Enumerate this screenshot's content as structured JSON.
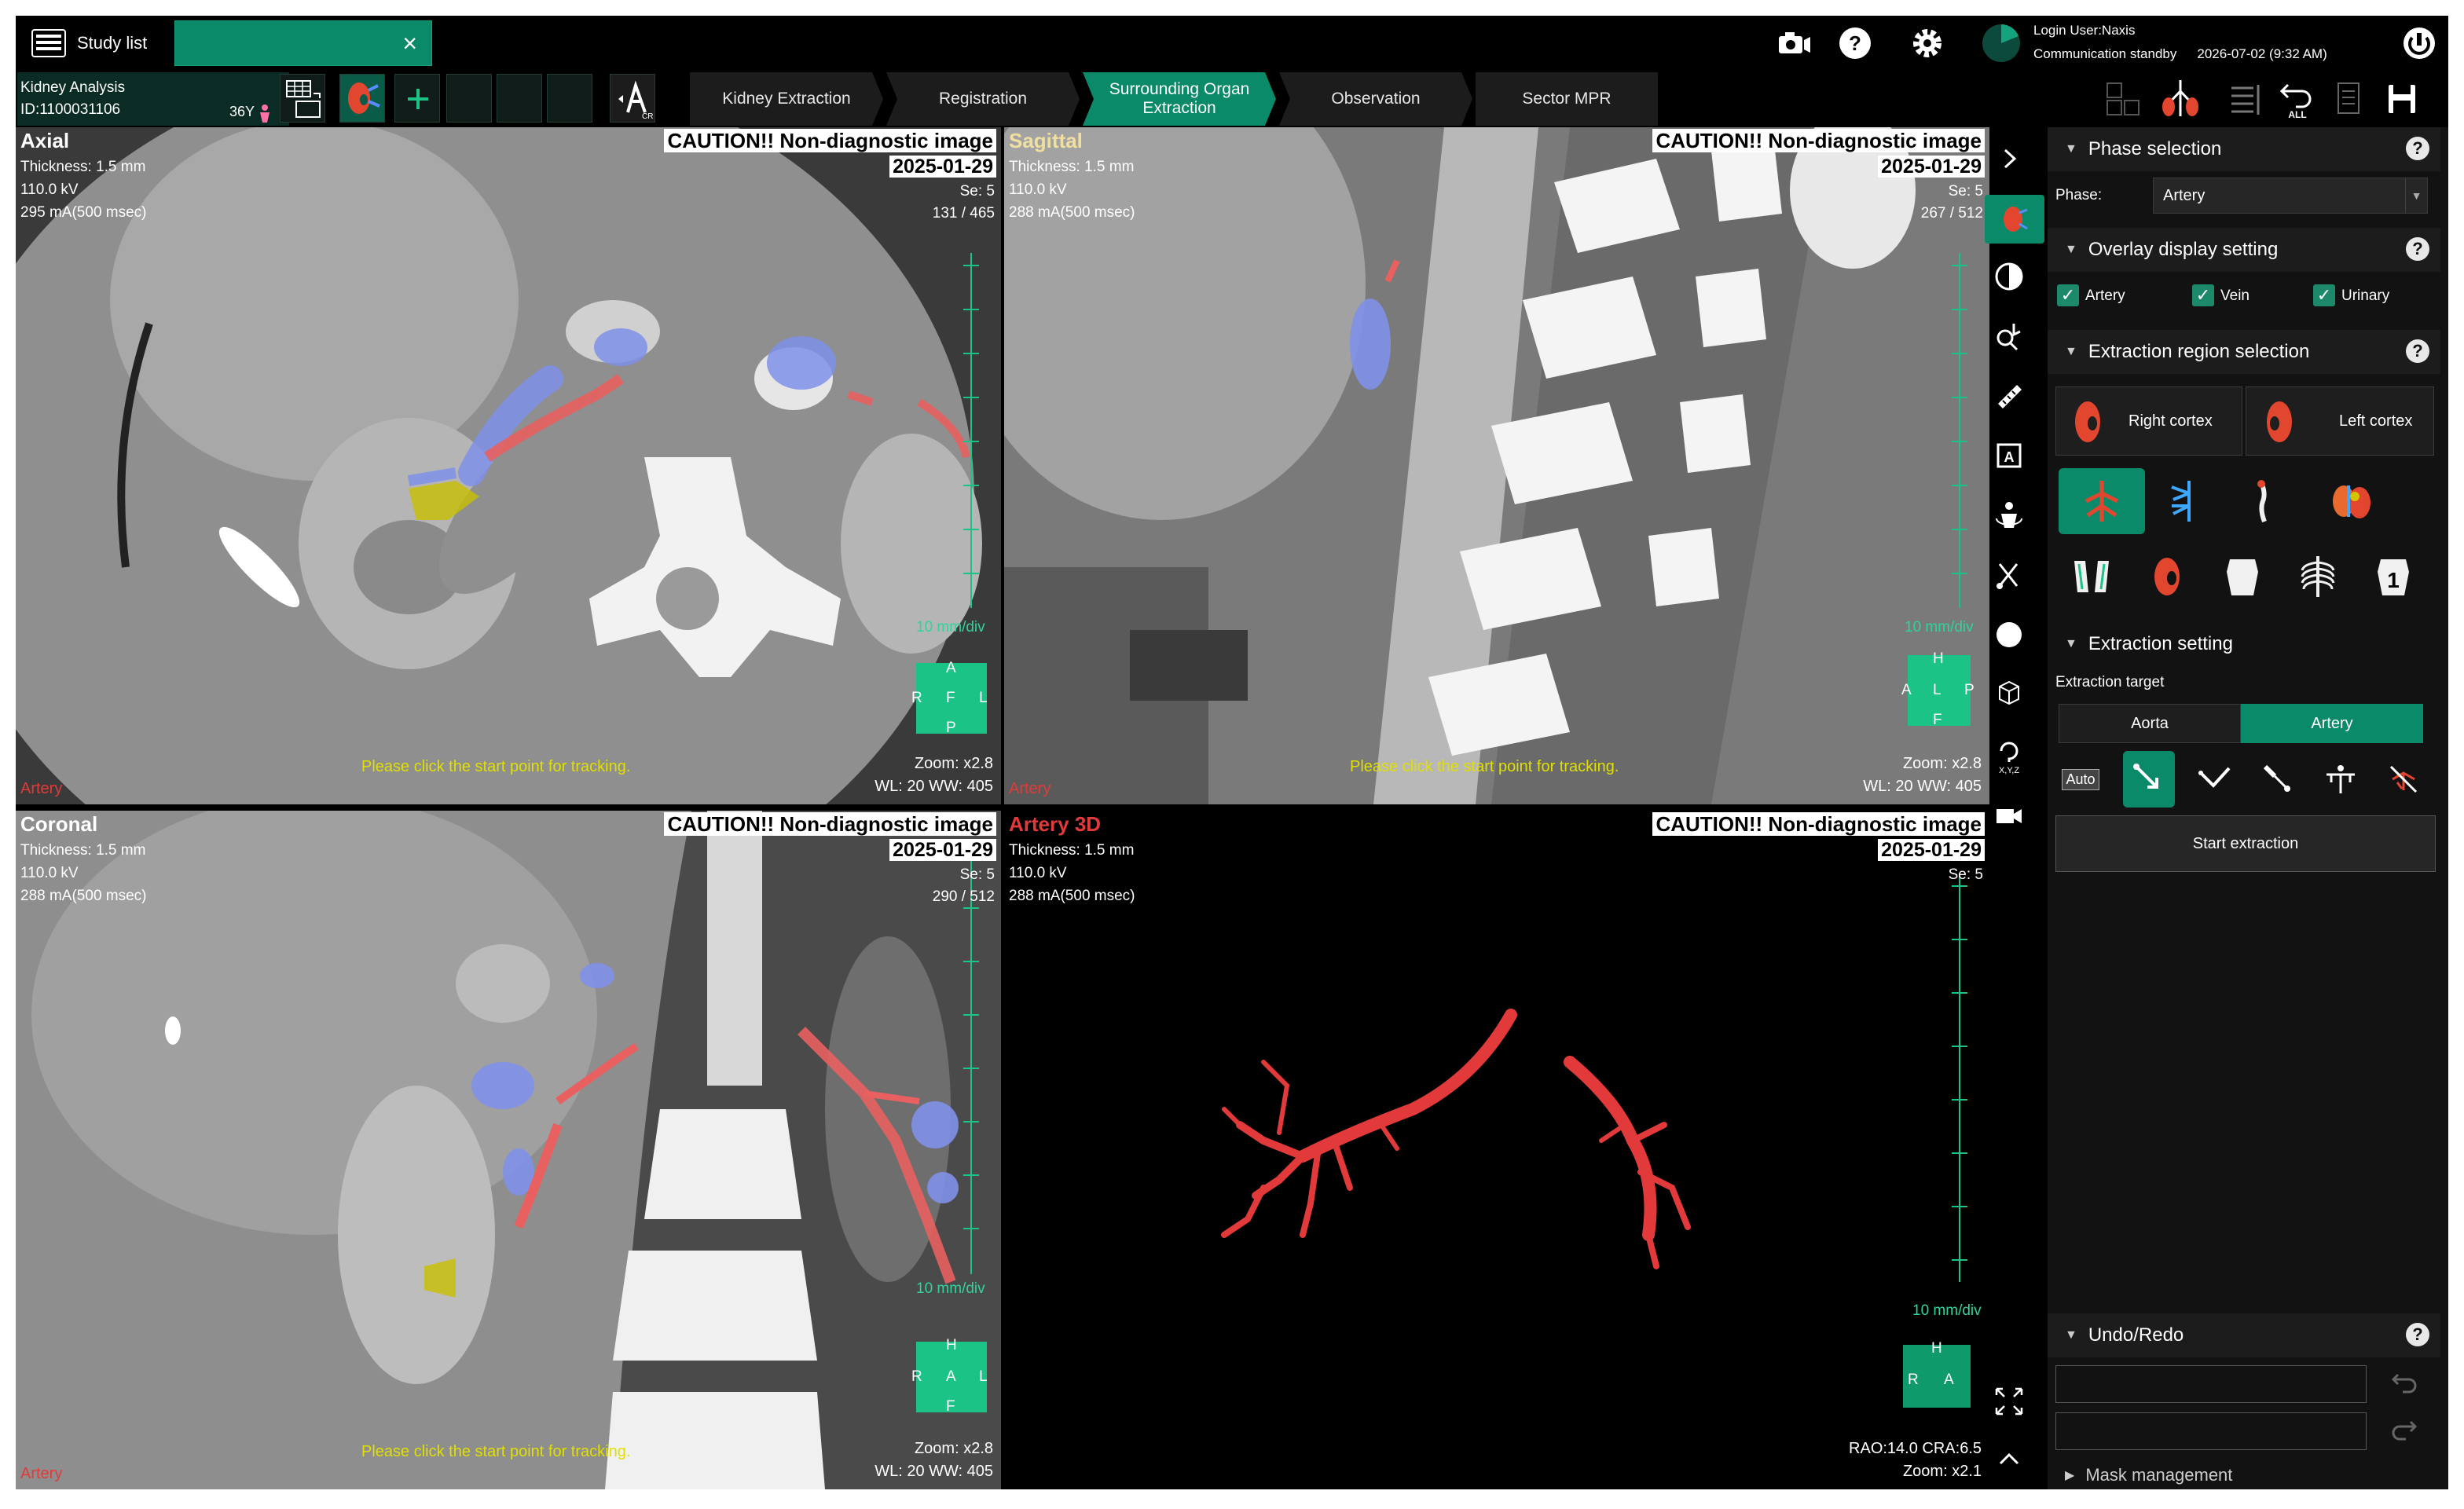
{
  "topbar": {
    "study_list_label": "Study list",
    "login_user": "Login User:Naxis",
    "comm_status": "Communication standby",
    "datetime": "2026-07-02 (9:32 AM)"
  },
  "study": {
    "analysis": "Kidney Analysis",
    "patient_id": "ID:1100031106",
    "age": "36Y"
  },
  "steps": [
    {
      "label": "Kidney Extraction"
    },
    {
      "label": "Registration"
    },
    {
      "label": "Surrounding Organ Extraction"
    },
    {
      "label": "Observation"
    },
    {
      "label": "Sector MPR"
    }
  ],
  "viewports": {
    "axial": {
      "name": "Axial",
      "thickness": "Thickness: 1.5 mm",
      "kv": "110.0 kV",
      "ma": "295 mA(500 msec)",
      "caution": "CAUTION!! Non-diagnostic image",
      "date": "2025-01-29",
      "se": "Se: 5",
      "slice": "131 / 465",
      "scale": "10  mm/div",
      "message": "Please click the start point for tracking.",
      "phase": "Artery",
      "zoom": "Zoom: x2.8",
      "wlww": "WL: 20  WW: 405",
      "orient": {
        "top": "A",
        "left": "R",
        "center": "F",
        "right": "L",
        "bottom": "P"
      }
    },
    "sagittal": {
      "name": "Sagittal",
      "thickness": "Thickness: 1.5 mm",
      "kv": "110.0 kV",
      "ma": "288 mA(500 msec)",
      "caution": "CAUTION!! Non-diagnostic image",
      "date": "2025-01-29",
      "se": "Se: 5",
      "slice": "267 / 512",
      "scale": "10  mm/div",
      "message": "Please click the start point for tracking.",
      "phase": "Artery",
      "zoom": "Zoom: x2.8",
      "wlww": "WL: 20  WW: 405",
      "orient": {
        "top": "H",
        "left": "A",
        "center": "L",
        "right": "P",
        "bottom": "F"
      }
    },
    "coronal": {
      "name": "Coronal",
      "thickness": "Thickness: 1.5 mm",
      "kv": "110.0 kV",
      "ma": "288 mA(500 msec)",
      "caution": "CAUTION!! Non-diagnostic image",
      "date": "2025-01-29",
      "se": "Se: 5",
      "slice": "290 / 512",
      "scale": "10  mm/div",
      "message": "Please click the start point for tracking.",
      "phase": "Artery",
      "zoom": "Zoom: x2.8",
      "wlww": "WL: 20  WW: 405",
      "orient": {
        "top": "H",
        "left": "R",
        "center": "A",
        "right": "L",
        "bottom": "F"
      }
    },
    "vr3d": {
      "name": "Artery 3D",
      "thickness": "Thickness: 1.5 mm",
      "kv": "110.0 kV",
      "ma": "288 mA(500 msec)",
      "caution": "CAUTION!! Non-diagnostic image",
      "date": "2025-01-29",
      "se": "Se: 5",
      "scale": "10  mm/div",
      "angle": "RAO:14.0 CRA:6.5",
      "zoom": "Zoom: x2.1",
      "orient": {
        "top": "H",
        "left": "R",
        "center": "A"
      }
    }
  },
  "panel": {
    "phase_section": "Phase selection",
    "phase_label": "Phase:",
    "phase_value": "Artery",
    "overlay_section": "Overlay display setting",
    "overlay": [
      "Artery",
      "Vein",
      "Urinary"
    ],
    "region_section": "Extraction region selection",
    "right_cortex": "Right cortex",
    "left_cortex": "Left cortex",
    "extraction_section": "Extraction setting",
    "extraction_target_label": "Extraction target",
    "target_aorta": "Aorta",
    "target_artery": "Artery",
    "auto_label": "Auto",
    "start_extraction": "Start extraction",
    "undo_section": "Undo/Redo",
    "mask_section": "Mask management"
  },
  "toolbar_icons": [
    "camera-icon",
    "help-icon",
    "settings-icon",
    "power-icon"
  ],
  "colors": {
    "accent": "#0a8a68",
    "artery": "#e23a3a",
    "vein": "#6b7fe8",
    "urinary": "#d6c300",
    "caution_text": "#e0e000"
  }
}
